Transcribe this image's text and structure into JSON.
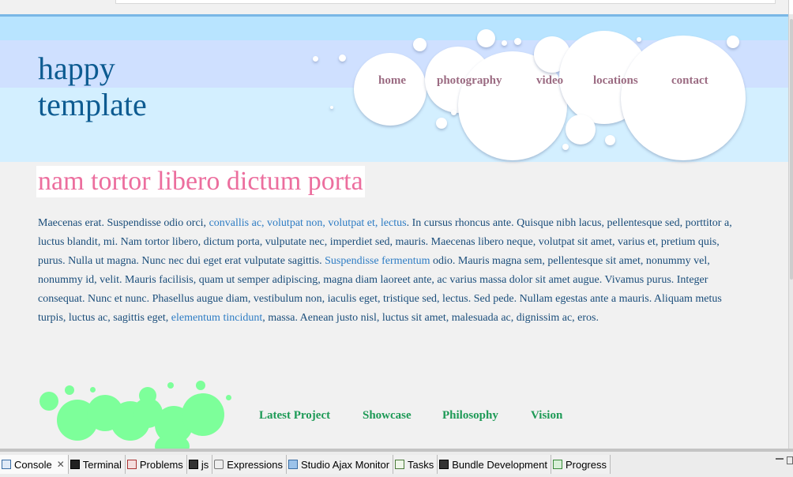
{
  "site": {
    "logo_line1": "happy",
    "logo_line2": "template"
  },
  "nav": [
    {
      "label": "home"
    },
    {
      "label": "photography"
    },
    {
      "label": "video"
    },
    {
      "label": "locations"
    },
    {
      "label": "contact"
    }
  ],
  "content": {
    "title": "nam tortor libero dictum porta",
    "text_1": "Maecenas erat. Suspendisse odio orci, ",
    "link_1": "convallis ac, volutpat non, volutpat et, lectus",
    "text_2": ". In cursus rhoncus ante. Quisque nibh lacus, pellentesque sed, porttitor a, luctus blandit, mi. Nam tortor libero, dictum porta, vulputate nec, imperdiet sed, mauris. Maecenas libero neque, volutpat sit amet, varius et, pretium quis, purus. Nulla ut magna. Nunc nec dui eget erat vulputate sagittis. ",
    "link_2": "Suspendisse fermentum",
    "text_3": " odio. Mauris magna sem, pellentesque sit amet, nonummy vel, nonummy id, velit. Mauris facilisis, quam ut semper adipiscing, magna diam laoreet ante, ac varius massa dolor sit amet augue. Vivamus purus. Integer consequat. Nunc et nunc. Phasellus augue diam, vestibulum non, iaculis eget, tristique sed, lectus. Sed pede. Nullam egestas ante a mauris. Aliquam metus turpis, luctus ac, sagittis eget, ",
    "link_3": "elementum tincidunt",
    "text_4": ", massa. Aenean justo nisl, luctus sit amet, malesuada ac, dignissim ac, eros."
  },
  "footer_nav": [
    {
      "label": "Latest Project"
    },
    {
      "label": "Showcase"
    },
    {
      "label": "Philosophy"
    },
    {
      "label": "Vision"
    }
  ],
  "ide_tabs": [
    {
      "label": "Console",
      "icon": "console-icon"
    },
    {
      "label": "Terminal",
      "icon": "terminal-icon"
    },
    {
      "label": "Problems",
      "icon": "problems-icon"
    },
    {
      "label": "js",
      "icon": "js-icon"
    },
    {
      "label": "Expressions",
      "icon": "expressions-icon"
    },
    {
      "label": "Studio Ajax Monitor",
      "icon": "ajax-monitor-icon"
    },
    {
      "label": "Tasks",
      "icon": "tasks-icon"
    },
    {
      "label": "Bundle Development",
      "icon": "bundle-icon"
    },
    {
      "label": "Progress",
      "icon": "progress-icon"
    }
  ],
  "colors": {
    "header_sky": "#d3efff",
    "header_band": "#cfe0ff",
    "logo": "#0d5b91",
    "nav": "#9b6b82",
    "title": "#ec6e9e",
    "body_text": "#1a4d7a",
    "link": "#2d7cc4",
    "footer_nav": "#1d9a56",
    "green_bubbles": "#7dff9a"
  }
}
